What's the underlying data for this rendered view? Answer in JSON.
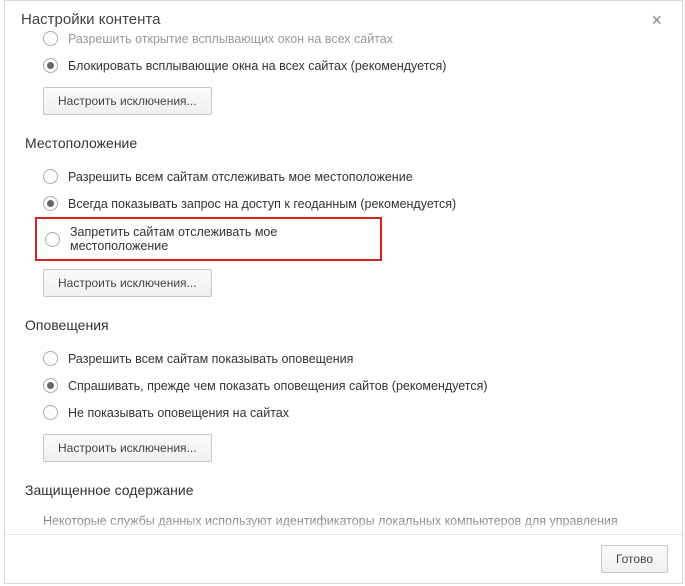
{
  "dialog": {
    "title": "Настройки контента",
    "close_glyph": "×",
    "done_label": "Готово"
  },
  "popups": {
    "opt_allow": "Разрешить открытие всплывающих окон на всех сайтах",
    "opt_block": "Блокировать всплывающие окна на всех сайтах (рекомендуется)",
    "exceptions": "Настроить исключения..."
  },
  "location": {
    "title": "Местоположение",
    "opt_allow": "Разрешить всем сайтам отслеживать мое местоположение",
    "opt_ask": "Всегда показывать запрос на доступ к геоданным (рекомендуется)",
    "opt_block": "Запретить сайтам отслеживать мое местоположение",
    "exceptions": "Настроить исключения..."
  },
  "notifications": {
    "title": "Оповещения",
    "opt_allow": "Разрешить всем сайтам показывать оповещения",
    "opt_ask": "Спрашивать, прежде чем показать оповещения сайтов (рекомендуется)",
    "opt_block": "Не показывать оповещения на сайтах",
    "exceptions": "Настроить исключения..."
  },
  "protected": {
    "title": "Защищенное содержание",
    "desc": "Некоторые службы данных используют идентификаторы локальных компьютеров для управления"
  }
}
